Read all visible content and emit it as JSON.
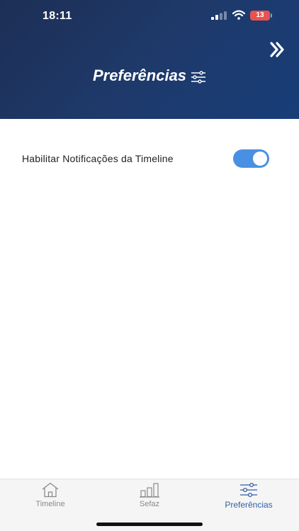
{
  "status_bar": {
    "time": "18:11",
    "battery_level": "13"
  },
  "header": {
    "title": "Preferências",
    "title_icon": "sliders-icon",
    "forward_icon": "double-chevron-right-icon"
  },
  "settings": [
    {
      "label": "Habilitar Notificações da Timeline",
      "enabled": true
    }
  ],
  "tab_bar": {
    "items": [
      {
        "label": "Timeline",
        "icon": "home-icon",
        "active": false
      },
      {
        "label": "Sefaz",
        "icon": "bar-chart-icon",
        "active": false
      },
      {
        "label": "Preferências",
        "icon": "sliders-icon",
        "active": true
      }
    ]
  },
  "colors": {
    "header_dark": "#1d2f55",
    "header_light": "#173d78",
    "toggle_on": "#4a90e2",
    "tab_active": "#2f5fa8",
    "tab_inactive": "#8a8a8a",
    "battery_low": "#e8534f"
  }
}
